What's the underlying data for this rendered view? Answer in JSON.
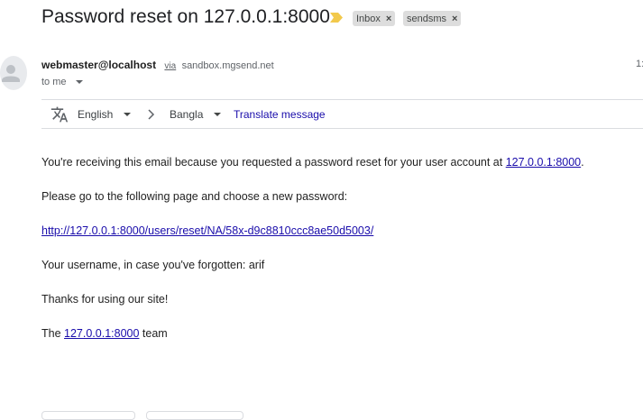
{
  "header": {
    "subject": "Password reset on 127.0.0.1:8000",
    "labels": [
      {
        "name": "Inbox",
        "remove": "×"
      },
      {
        "name": "sendsms",
        "remove": "×"
      }
    ]
  },
  "message": {
    "sender_name": "webmaster@localhost",
    "via_label": "via",
    "via_domain": "sandbox.mgsend.net",
    "time": "1:",
    "recipient": "to me"
  },
  "translate_bar": {
    "from_language": "English",
    "to_language": "Bangla",
    "action": "Translate message"
  },
  "email_body": {
    "line1_text": "You're receiving this email because you requested a password reset for your user account at ",
    "line1_link": "127.0.0.1:8000",
    "line1_end": ".",
    "line2": "Please go to the following page and choose a new password:",
    "reset_link": "http://127.0.0.1:8000/users/reset/NA/58x-d9c8810ccc8ae50d5003/",
    "line4": "Your username, in case you've forgotten: arif",
    "line5": "Thanks for using our site!",
    "sign_prefix": "The ",
    "sign_link": "127.0.0.1:8000",
    "sign_suffix": " team"
  },
  "colors": {
    "link": "#1a0dab",
    "important_marker": "#f2c94c",
    "label_chip": "#dddddd"
  },
  "icons": [
    "important-marker-icon",
    "close-icon",
    "avatar-person-icon",
    "chevron-down-icon",
    "translate-icon",
    "chevron-right-icon"
  ]
}
